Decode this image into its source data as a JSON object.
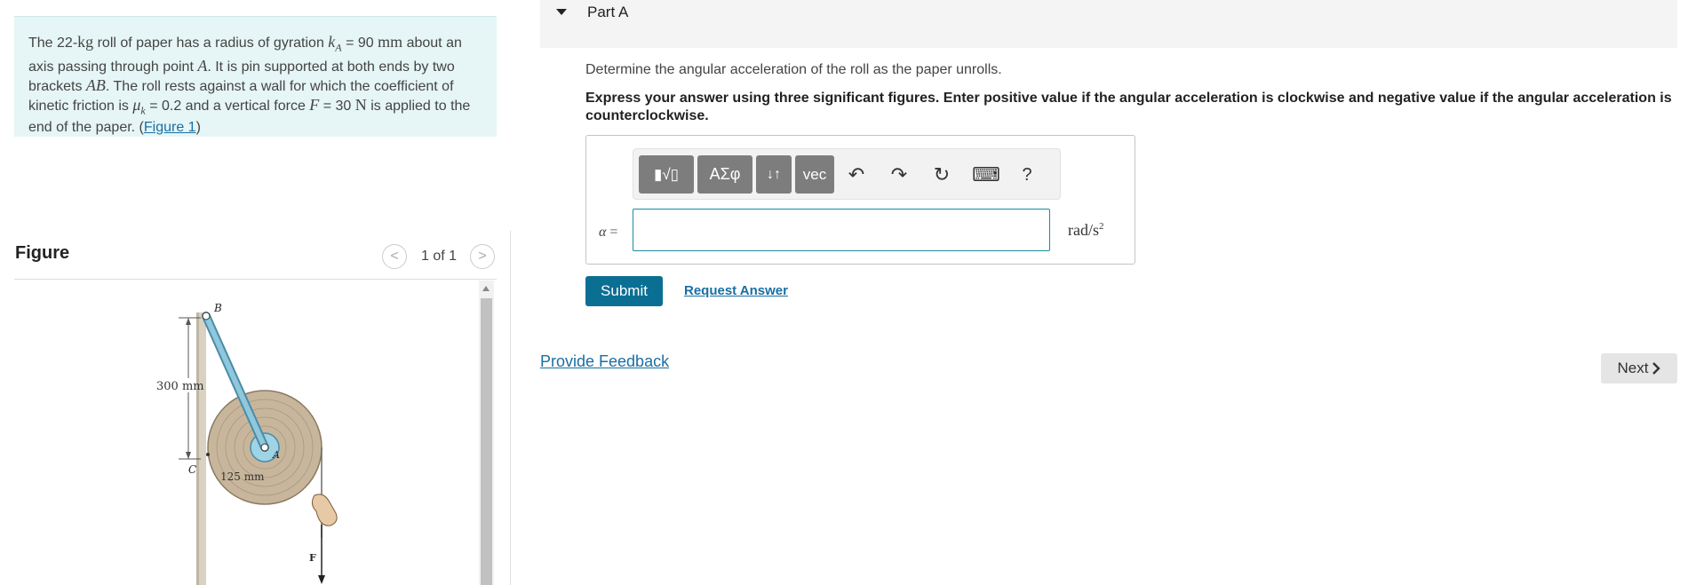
{
  "problem": {
    "p1": "The 22-",
    "kg": "kg",
    "p2": " roll of paper has a radius of gyration ",
    "kA_sym": "k",
    "kA_sub": "A",
    "p3": " = 90 ",
    "mm": "mm",
    "p4": " about an axis passing through point ",
    "A": "A",
    "p5": ". It is pin supported at both ends by two brackets ",
    "AB": "AB",
    "p6": ". The roll rests against a wall for which the coefficient of kinetic friction is ",
    "mu": "μ",
    "mu_sub": "k",
    "p7": " = 0.2 and a vertical force ",
    "F": "F",
    "p8": " = 30  ",
    "N": "N",
    "p9": " is applied to the end of the paper. (",
    "figure_link": "Figure 1",
    "p10": ")"
  },
  "figure": {
    "title": "Figure",
    "count": "1 of 1",
    "prev": "<",
    "next": ">",
    "labels": {
      "B": "B",
      "C": "C",
      "A": "A",
      "F": "F",
      "dim300": "300 mm",
      "dim125": "125 mm"
    }
  },
  "part": {
    "title": "Part A",
    "question": "Determine the angular acceleration of the roll as the paper unrolls.",
    "instruction": "Express your answer using three significant figures. Enter positive value if the angular acceleration is clockwise and negative value if the angular acceleration is counterclockwise.",
    "toolbar": {
      "templates": "▮√▯",
      "greek": "ΑΣφ",
      "arrows": "↓↑",
      "vec": "vec",
      "undo": "↶",
      "redo": "↷",
      "reset": "↻",
      "keyboard": "⌨",
      "help": "?"
    },
    "variable": "α",
    "equals": " =",
    "answer_value": "",
    "unit_base": "rad/s",
    "unit_exp": "2",
    "submit": "Submit",
    "request": "Request Answer"
  },
  "feedback": "Provide Feedback",
  "next": "Next",
  "colors": {
    "accent": "#0b6f93",
    "link": "#1a6fa3",
    "problem_bg": "#e6f5f5",
    "toolbar_btn": "#7d7d7d"
  }
}
